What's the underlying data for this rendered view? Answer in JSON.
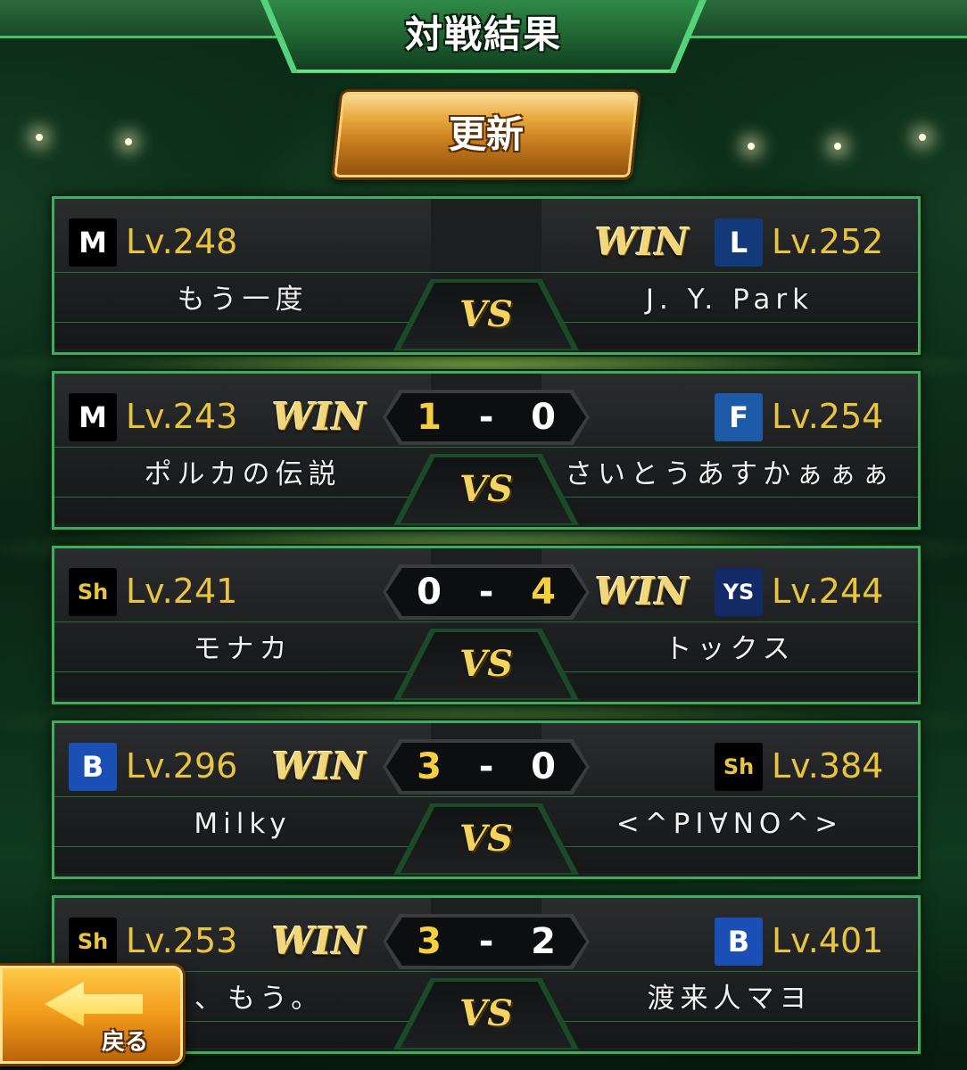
{
  "screen": {
    "title": "対戦結果",
    "refresh_label": "更新",
    "vs_label": "VS",
    "win_label": "WIN",
    "back_label": "戻る"
  },
  "matches": [
    {
      "left": {
        "team_icon": "marines-icon",
        "icon_glyph": "M",
        "icon_bg": "#000000",
        "icon_color": "#ffffff",
        "level": "Lv.248",
        "name": "もう一度",
        "win": false
      },
      "right": {
        "team_icon": "lions-icon",
        "icon_glyph": "L",
        "icon_bg": "#123a7a",
        "icon_color": "#ffffff",
        "level": "Lv.252",
        "name": "J. Y. Park",
        "win": true
      },
      "score": null
    },
    {
      "left": {
        "team_icon": "marines-icon",
        "icon_glyph": "M",
        "icon_bg": "#000000",
        "icon_color": "#ffffff",
        "level": "Lv.243",
        "name": "ポルカの伝説",
        "win": true
      },
      "right": {
        "team_icon": "fighters-icon",
        "icon_glyph": "F",
        "icon_bg": "#1d5aa8",
        "icon_color": "#ffffff",
        "level": "Lv.254",
        "name": "さいとうあすかぁぁぁ",
        "win": false
      },
      "score": {
        "left": "1",
        "right": "0"
      }
    },
    {
      "left": {
        "team_icon": "hawks-icon",
        "icon_glyph": "Sh",
        "icon_bg": "#000000",
        "icon_color": "#e9c441",
        "level": "Lv.241",
        "name": "モナカ",
        "win": false
      },
      "right": {
        "team_icon": "swallows-icon",
        "icon_glyph": "YS",
        "icon_bg": "#142a66",
        "icon_color": "#ffffff",
        "level": "Lv.244",
        "name": "トックス",
        "win": true
      },
      "score": {
        "left": "0",
        "right": "4"
      }
    },
    {
      "left": {
        "team_icon": "baystars-icon",
        "icon_glyph": "B",
        "icon_bg": "#1a4fb5",
        "icon_color": "#ffffff",
        "level": "Lv.296",
        "name": "Milky",
        "win": true
      },
      "right": {
        "team_icon": "hawks-icon",
        "icon_glyph": "Sh",
        "icon_bg": "#000000",
        "icon_color": "#e9c441",
        "level": "Lv.384",
        "name": "<^PI∀NO^>",
        "win": false
      },
      "score": {
        "left": "3",
        "right": "0"
      }
    },
    {
      "left": {
        "team_icon": "hawks-icon",
        "icon_glyph": "Sh",
        "icon_bg": "#000000",
        "icon_color": "#e9c441",
        "level": "Lv.253",
        "name": "ら、もう。",
        "win": true
      },
      "right": {
        "team_icon": "baystars-icon",
        "icon_glyph": "B",
        "icon_bg": "#1a4fb5",
        "icon_color": "#ffffff",
        "level": "Lv.401",
        "name": "渡来人マヨ",
        "win": false
      },
      "score": {
        "left": "3",
        "right": "2"
      }
    }
  ]
}
